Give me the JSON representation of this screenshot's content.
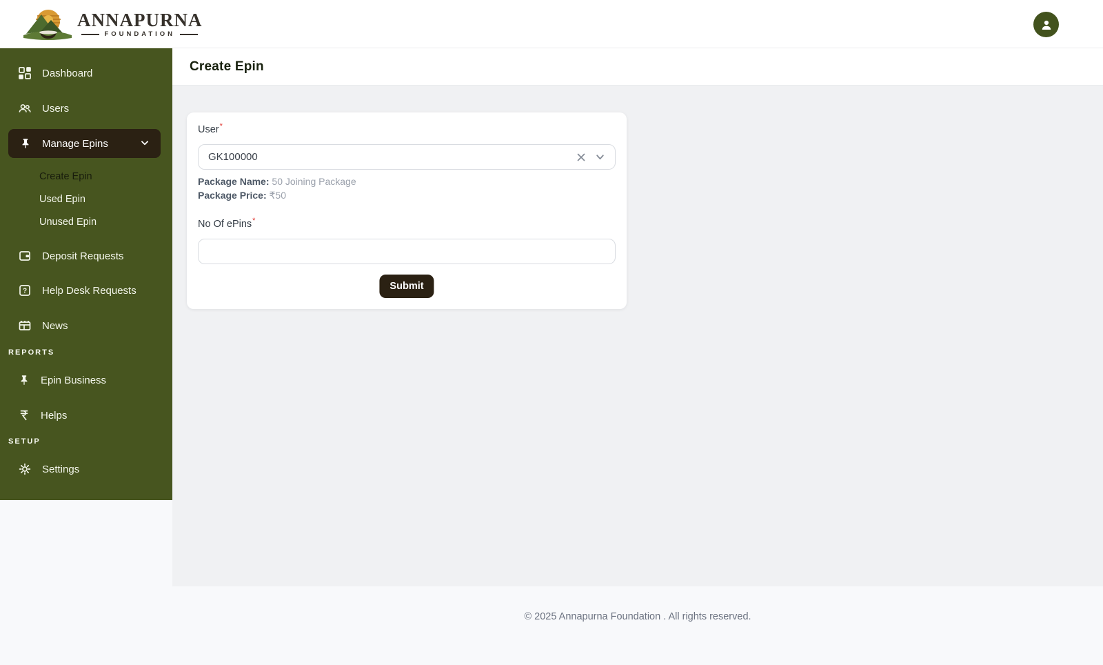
{
  "colors": {
    "sidebar_bg": "#47551f",
    "active_item_bg": "#2b2113",
    "submit_bg": "#2b2113",
    "content_bg": "#f0f1f3",
    "page_bg": "#f8f9fb",
    "required_red": "#e0322c",
    "avatar_bg": "#42521d"
  },
  "header": {
    "brand_name": "ANNAPURNA",
    "brand_tagline": "FOUNDATION",
    "avatar_icon": "person-icon"
  },
  "sidebar": {
    "items": [
      {
        "label": "Dashboard",
        "icon": "dashboard-icon"
      },
      {
        "label": "Users",
        "icon": "users-icon"
      },
      {
        "label": "Manage Epins",
        "icon": "pin-icon",
        "state": "active-expanded",
        "children": [
          "Create Epin",
          "Used Epin",
          "Unused Epin"
        ],
        "active_child": "Create Epin"
      },
      {
        "label": "Deposit Requests",
        "icon": "wallet-icon"
      },
      {
        "label": "Help Desk Requests",
        "icon": "help-icon"
      },
      {
        "label": "News",
        "icon": "news-icon"
      }
    ],
    "sections": [
      {
        "label": "REPORTS",
        "items": [
          {
            "label": "Epin Business",
            "icon": "pin-icon"
          },
          {
            "label": "Helps",
            "icon": "rupee-icon"
          }
        ]
      },
      {
        "label": "SETUP",
        "items": [
          {
            "label": "Settings",
            "icon": "gear-icon"
          }
        ]
      }
    ]
  },
  "page": {
    "title": "Create Epin"
  },
  "form": {
    "user_label": "User",
    "required_mark": "*",
    "user_value": "GK100000",
    "package_name_label": "Package Name:",
    "package_name_value": "50 Joining Package",
    "package_price_label": "Package Price:",
    "package_price_value": "₹50",
    "epins_label": "No Of ePins",
    "epins_value": "",
    "submit_label": "Submit"
  },
  "footer": {
    "copyright": "© 2025 Annapurna Foundation . All rights reserved."
  }
}
